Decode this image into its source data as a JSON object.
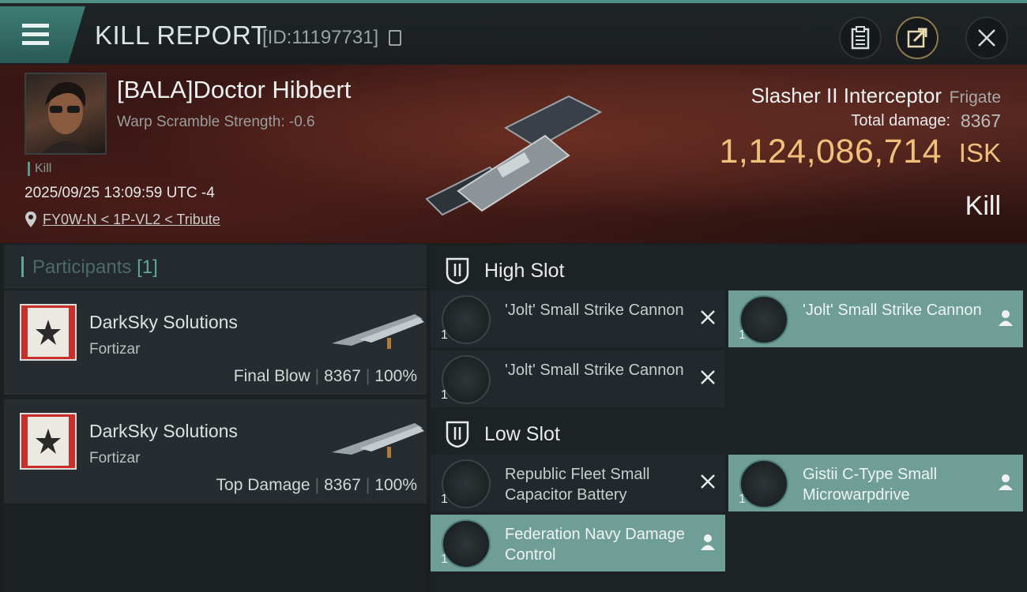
{
  "header": {
    "title": "KILL REPORT",
    "report_id": "[ID:11197731]"
  },
  "victim": {
    "name": "[BALA]Doctor Hibbert",
    "subtitle": "Warp Scramble Strength: -0.6",
    "tag": "Kill",
    "datetime": "2025/09/25 13:09:59 UTC -4",
    "location": "FY0W-N < 1P-VL2 < Tribute"
  },
  "ship": {
    "name": "Slasher II Interceptor",
    "class": "Frigate",
    "damage_label": "Total damage:",
    "damage_value": "8367",
    "isk_value": "1,124,086,714",
    "isk_unit": "ISK",
    "result": "Kill"
  },
  "participants": {
    "header": "Participants",
    "count": "[1]",
    "cards": [
      {
        "name": "DarkSky Solutions",
        "ship": "Fortizar",
        "role": "Final Blow",
        "damage": "8367",
        "percent": "100%"
      },
      {
        "name": "DarkSky Solutions",
        "ship": "Fortizar",
        "role": "Top Damage",
        "damage": "8367",
        "percent": "100%"
      }
    ]
  },
  "slots": {
    "high_label": "High Slot",
    "low_label": "Low Slot",
    "high": [
      {
        "name": "'Jolt' Small Strike Cannon",
        "qty": "1",
        "state": "destroyed"
      },
      {
        "name": "'Jolt' Small Strike Cannon",
        "qty": "1",
        "state": "dropped"
      },
      {
        "name": "'Jolt' Small Strike Cannon",
        "qty": "1",
        "state": "destroyed"
      }
    ],
    "low": [
      {
        "name": "Republic Fleet Small Capacitor Battery",
        "qty": "1",
        "state": "destroyed"
      },
      {
        "name": "Gistii C-Type Small Microwarpdrive",
        "qty": "1",
        "state": "dropped"
      },
      {
        "name": "Federation Navy Damage Control",
        "qty": "1",
        "state": "dropped"
      }
    ]
  },
  "icons": {
    "menu": "hamburger-icon",
    "copy": "copy-icon",
    "clipboard": "clipboard-icon",
    "share": "share-icon",
    "close": "close-icon",
    "location": "location-pin-icon",
    "slot": "slot-icon",
    "destroyed": "x-icon",
    "dropped": "person-icon"
  },
  "colors": {
    "accent": "#6f9e97",
    "isk": "#f1c07a",
    "corp_red": "#c7302a"
  }
}
